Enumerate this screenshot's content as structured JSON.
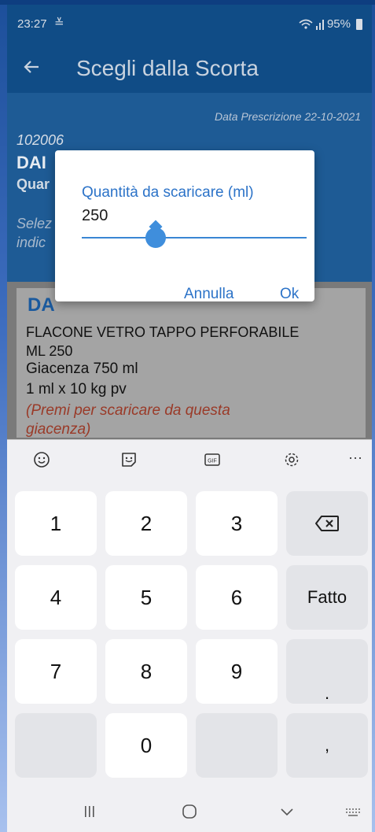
{
  "status_bar": {
    "time": "23:27",
    "download_glyph": "≚",
    "battery": "95%"
  },
  "app_bar": {
    "title": "Scegli dalla Scorta",
    "back_icon": "arrow-left"
  },
  "header": {
    "rx_date": "Data Prescrizione 22-10-2021",
    "code": "102006",
    "drug_name_partial": "DAI",
    "qty_partial": "Quar",
    "select_hint_line1": "Selez",
    "select_hint_line2": "indic"
  },
  "card": {
    "title_partial": "DA",
    "desc_line1": "FLACONE VETRO TAPPO PERFORABILE",
    "desc_line2": "ML 250",
    "stock": "Giacenza  750 ml",
    "dose": "1 ml x 10 kg pv",
    "hint_line1": "(Premi per scaricare da questa",
    "hint_line2": "giacenza)"
  },
  "dialog": {
    "label": "Quantità da scaricare (ml)",
    "value": "250",
    "slider_fraction": 0.33,
    "cancel": "Annulla",
    "ok": "Ok"
  },
  "keyboard": {
    "toolbar_icons": [
      "smiley-icon",
      "sticker-icon",
      "gif-icon",
      "settings-icon",
      "more-icon"
    ],
    "gif_label": "GIF",
    "more_label": "···",
    "rows": [
      [
        "1",
        "2",
        "3",
        "⌫"
      ],
      [
        "4",
        "5",
        "6",
        "Fatto"
      ],
      [
        "7",
        "8",
        "9",
        "."
      ],
      [
        "",
        "0",
        "",
        ","
      ]
    ]
  },
  "colors": {
    "accent": "#2c73c8",
    "app_bar": "#104c86",
    "hint_red": "#9a3a28"
  }
}
